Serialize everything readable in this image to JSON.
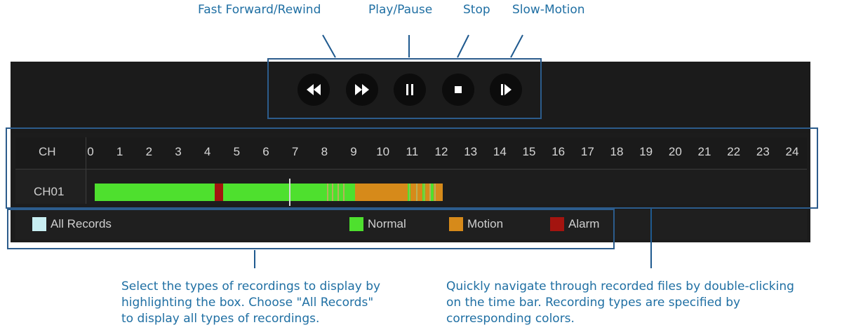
{
  "callouts": {
    "fast_forward_rewind": "Fast Forward/Rewind",
    "play_pause": "Play/Pause",
    "stop": "Stop",
    "slow_motion": "Slow-Motion",
    "select_types_line1": "Select the types of recordings to display by",
    "select_types_line2": "highlighting the box.  Choose \"All Records\"",
    "select_types_line3": "to display all types of recordings.",
    "navigate_line1": "Quickly navigate through recorded files by double-clicking",
    "navigate_line2": "on the time bar.  Recording types are specified by",
    "navigate_line3": "corresponding colors."
  },
  "controls": [
    {
      "name": "rewind",
      "icon": "rewind-icon"
    },
    {
      "name": "fast-forward",
      "icon": "fast-forward-icon"
    },
    {
      "name": "pause",
      "icon": "pause-icon"
    },
    {
      "name": "stop",
      "icon": "stop-icon"
    },
    {
      "name": "slow-motion",
      "icon": "slow-motion-icon"
    }
  ],
  "timeline": {
    "header_label": "CH",
    "channel_label": "CH01",
    "hours": [
      "0",
      "1",
      "2",
      "3",
      "4",
      "5",
      "6",
      "7",
      "8",
      "9",
      "10",
      "11",
      "12",
      "13",
      "14",
      "15",
      "16",
      "17",
      "18",
      "19",
      "20",
      "21",
      "22",
      "23",
      "24"
    ],
    "recordings": [
      {
        "type": "normal",
        "start_hour": 0.0,
        "end_hour": 4.1
      },
      {
        "type": "alarm",
        "start_hour": 4.1,
        "end_hour": 4.4
      },
      {
        "type": "normal",
        "start_hour": 4.4,
        "end_hour": 7.9
      },
      {
        "type": "normal",
        "start_hour": 7.9,
        "end_hour": 8.9
      },
      {
        "type": "motion",
        "start_hour": 8.9,
        "end_hour": 10.7
      },
      {
        "type": "normal",
        "start_hour": 10.7,
        "end_hour": 10.8
      },
      {
        "type": "motion",
        "start_hour": 10.8,
        "end_hour": 11.2
      },
      {
        "type": "normal",
        "start_hour": 11.2,
        "end_hour": 11.3
      },
      {
        "type": "motion",
        "start_hour": 11.3,
        "end_hour": 11.5
      },
      {
        "type": "normal",
        "start_hour": 11.5,
        "end_hour": 11.6
      },
      {
        "type": "motion",
        "start_hour": 11.6,
        "end_hour": 11.9
      }
    ],
    "cursor_hour": 6.65
  },
  "legend": {
    "all_records": "All Records",
    "normal": "Normal",
    "motion": "Motion",
    "alarm": "Alarm"
  },
  "colors": {
    "normal": "#4ee02e",
    "motion": "#d68a1a",
    "alarm": "#a3140f",
    "all_records": "#c8eef2",
    "callout_text": "#1f6fa3"
  }
}
